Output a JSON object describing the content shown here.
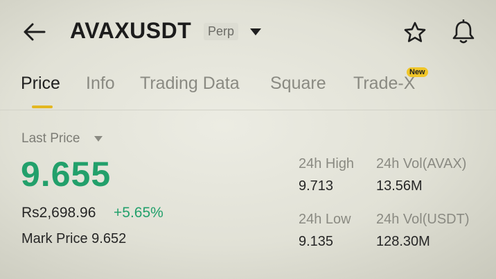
{
  "header": {
    "title": "AVAXUSDT",
    "contract_type": "Perp"
  },
  "tabs": [
    {
      "label": "Price",
      "active": true
    },
    {
      "label": "Info",
      "active": false
    },
    {
      "label": "Trading Data",
      "active": false
    },
    {
      "label": "Square",
      "active": false
    },
    {
      "label": "Trade-X",
      "active": false,
      "badge": "New"
    }
  ],
  "price": {
    "last_price_label": "Last Price",
    "last_price": "9.655",
    "fiat_value": "Rs2,698.96",
    "change_pct": "+5.65%",
    "mark_price_label": "Mark Price",
    "mark_price": "9.652"
  },
  "stats": {
    "high_label": "24h High",
    "high_value": "9.713",
    "low_label": "24h Low",
    "low_value": "9.135",
    "vol_base_label": "24h Vol(AVAX)",
    "vol_base_value": "13.56M",
    "vol_quote_label": "24h Vol(USDT)",
    "vol_quote_value": "128.30M"
  },
  "colors": {
    "up": "#22a06b",
    "accent": "#e3b721",
    "badge": "#f0c629"
  },
  "icons": [
    "back-arrow-icon",
    "caret-down-icon",
    "star-icon",
    "bell-icon"
  ]
}
